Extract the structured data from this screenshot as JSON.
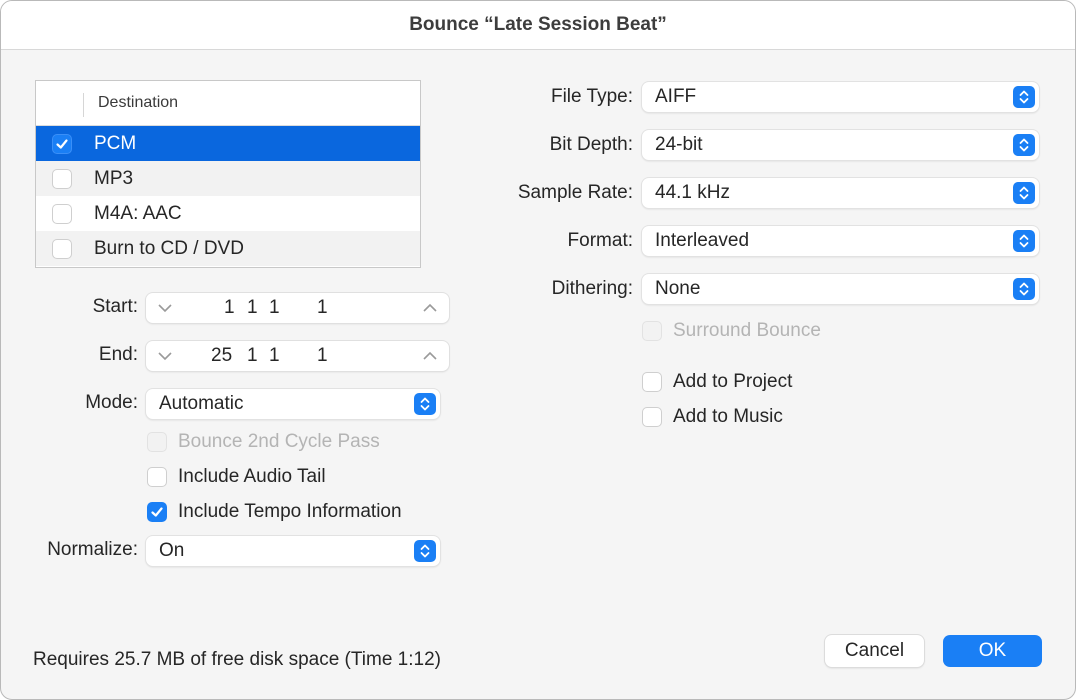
{
  "window": {
    "title": "Bounce “Late Session Beat”"
  },
  "destination": {
    "header": "Destination",
    "rows": [
      {
        "label": "PCM",
        "checked": true,
        "selected": true
      },
      {
        "label": "MP3",
        "checked": false,
        "selected": false
      },
      {
        "label": "M4A: AAC",
        "checked": false,
        "selected": false
      },
      {
        "label": "Burn to CD / DVD",
        "checked": false,
        "selected": false
      }
    ]
  },
  "left_form": {
    "start": {
      "label": "Start:",
      "values": [
        "1",
        "1",
        "1",
        "1"
      ]
    },
    "end": {
      "label": "End:",
      "values": [
        "25",
        "1",
        "1",
        "1"
      ]
    },
    "mode": {
      "label": "Mode:",
      "value": "Automatic"
    },
    "bounce_2nd_cycle": {
      "label": "Bounce 2nd Cycle Pass",
      "checked": false,
      "disabled": true
    },
    "include_audio_tail": {
      "label": "Include Audio Tail",
      "checked": false,
      "disabled": false
    },
    "include_tempo": {
      "label": "Include Tempo Information",
      "checked": true,
      "disabled": false
    },
    "normalize": {
      "label": "Normalize:",
      "value": "On"
    }
  },
  "right_form": {
    "file_type": {
      "label": "File Type:",
      "value": "AIFF"
    },
    "bit_depth": {
      "label": "Bit Depth:",
      "value": "24-bit"
    },
    "sample_rate": {
      "label": "Sample Rate:",
      "value": "44.1 kHz"
    },
    "format": {
      "label": "Format:",
      "value": "Interleaved"
    },
    "dithering": {
      "label": "Dithering:",
      "value": "None"
    },
    "surround_bounce": {
      "label": "Surround Bounce",
      "checked": false,
      "disabled": true
    },
    "add_to_project": {
      "label": "Add to Project",
      "checked": false
    },
    "add_to_music": {
      "label": "Add to Music",
      "checked": false
    }
  },
  "footer": {
    "status": "Requires 25.7 MB of free disk space  (Time 1:12)",
    "cancel_label": "Cancel",
    "ok_label": "OK"
  },
  "colors": {
    "accent": "#1a7ff5",
    "selection": "#0a67de"
  }
}
